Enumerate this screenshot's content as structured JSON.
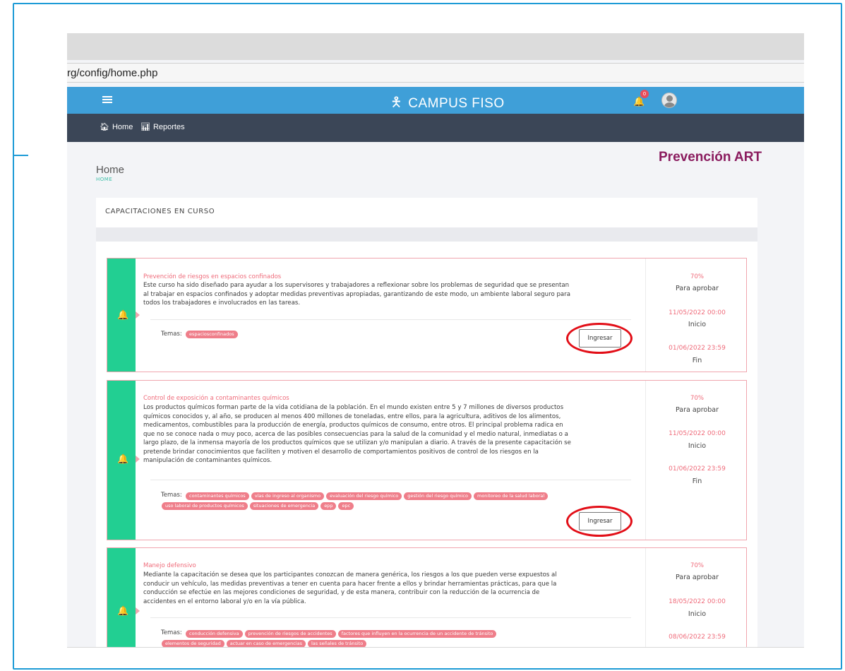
{
  "browser": {
    "address": "rg/config/home.php"
  },
  "topbar": {
    "brand": "CAMPUS FISO",
    "notification_count": "0"
  },
  "nav": {
    "items": [
      {
        "label": "Home"
      },
      {
        "label": "Reportes"
      }
    ]
  },
  "logo": {
    "text": "Prevención ART"
  },
  "page": {
    "title": "Home",
    "breadcrumb": "HOME"
  },
  "section": {
    "title": "CAPACITACIONES EN CURSO"
  },
  "courses": [
    {
      "title": "Prevención de riesgos en espacios confinados",
      "desc_lines": [
        "Este curso ha sido diseñado para ayudar a los supervisores y trabajadores a reflexionar sobre los problemas de seguridad que se presentan",
        "al trabajar en espacios confinados y adoptar medidas preventivas apropiadas, garantizando de este modo, un ambiente laboral seguro para",
        "todos los trabajadores e involucrados en las tareas."
      ],
      "temas_label": "Temas:",
      "tags": [
        [
          "espaciosconfinados"
        ]
      ],
      "button": "Ingresar",
      "pct": "70%",
      "pct_label": "Para aprobar",
      "start": "11/05/2022 00:00",
      "start_label": "Inicio",
      "end": "01/06/2022 23:59",
      "end_label": "Fin"
    },
    {
      "title": "Control de exposición a contaminantes químicos",
      "desc_lines": [
        "Los productos químicos forman parte de la vida cotidiana de la población. En el mundo existen entre 5 y 7 millones de diversos productos",
        "químicos conocidos y, al año, se producen al menos 400 millones de toneladas, entre ellos, para la agricultura, aditivos de los alimentos,",
        "medicamentos, combustibles para la producción de energía, productos químicos de consumo, entre otros. El principal problema radica en",
        "que no se conoce nada o muy poco, acerca de las posibles consecuencias para la salud de la comunidad y el medio natural, inmediatas o a",
        "largo plazo, de la inmensa mayoría de los productos químicos que se utilizan y/o manipulan a diario. A través de la presente capacitación se",
        "pretende brindar conocimientos que faciliten y motiven el desarrollo de comportamientos positivos de control de los riesgos en la",
        "manipulación de contaminantes químicos."
      ],
      "temas_label": "Temas:",
      "tags": [
        [
          "contaminantes químicos",
          "vías de ingreso al organismo",
          "evaluación del riesgo químico",
          "gestión del riesgo químico",
          "monitoreo de la salud laboral"
        ],
        [
          "uso laboral de productos químicos",
          "situaciones de emergencia",
          "epp",
          "epc"
        ]
      ],
      "button": "Ingresar",
      "pct": "70%",
      "pct_label": "Para aprobar",
      "start": "11/05/2022 00:00",
      "start_label": "Inicio",
      "end": "01/06/2022 23:59",
      "end_label": "Fin"
    },
    {
      "title": "Manejo defensivo",
      "desc_lines": [
        "Mediante la capacitación se desea que los participantes conozcan de manera genérica, los riesgos a los que pueden verse expuestos al",
        "conducir un vehículo, las medidas preventivas a tener en cuenta para hacer frente a ellos y brindar herramientas prácticas, para que la",
        "conducción se efectúe en las mejores condiciones de seguridad, y de esta manera, contribuir con la reducción de la ocurrencia de",
        "accidentes en el entorno laboral y/o en la vía pública."
      ],
      "temas_label": "Temas:",
      "tags": [
        [
          "conducción defensiva",
          "prevención de riesgos de accidentes",
          "factores que influyen en la ocurrencia de un accidente de tránsito"
        ],
        [
          "elementos de seguridad",
          "actuar en caso de emergencias",
          "las señales de tránsito"
        ]
      ],
      "pct": "70%",
      "pct_label": "Para aprobar",
      "start": "18/05/2022 00:00",
      "start_label": "Inicio",
      "end": "08/06/2022 23:59"
    }
  ],
  "colors": {
    "topbar": "#3f9fd8",
    "navbar": "#3b4657",
    "accent_green": "#22cf92",
    "accent_pink": "#ef6b7a",
    "highlight_ring": "#e20e17",
    "logo": "#8a1b5e"
  }
}
